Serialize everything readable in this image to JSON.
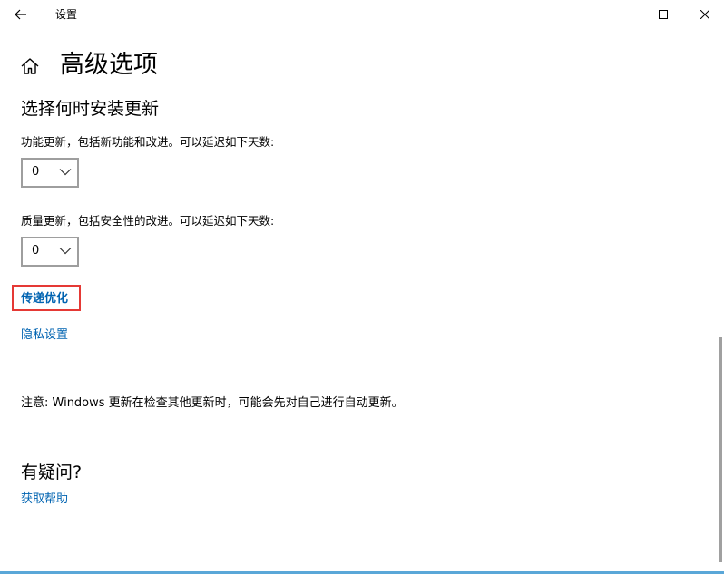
{
  "window": {
    "title": "设置",
    "icons": {
      "back": "back-arrow-icon",
      "minimize": "minimize-icon",
      "maximize": "maximize-icon",
      "close": "close-icon"
    }
  },
  "header": {
    "home_icon": "home-icon",
    "title": "高级选项"
  },
  "install_section": {
    "title": "选择何时安装更新",
    "feature_updates": {
      "label": "功能更新，包括新功能和改进。可以延迟如下天数:",
      "value": "0"
    },
    "quality_updates": {
      "label": "质量更新，包括安全性的改进。可以延迟如下天数:",
      "value": "0"
    }
  },
  "links": {
    "delivery_optimization": "传递优化",
    "privacy_settings": "隐私设置"
  },
  "note": "注意: Windows 更新在检查其他更新时，可能会先对自己进行自动更新。",
  "help": {
    "title": "有疑问?",
    "link": "获取帮助"
  },
  "colors": {
    "link": "#0063b1",
    "highlight": "#e53935",
    "accent_strip": "#5aa7d8"
  }
}
